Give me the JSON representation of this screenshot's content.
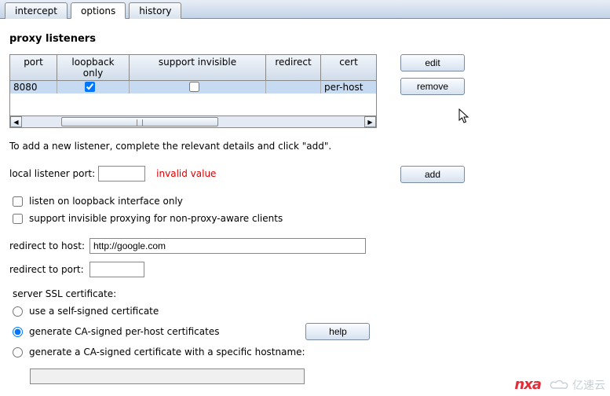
{
  "tabs": {
    "intercept": "intercept",
    "options": "options",
    "history": "history",
    "active": "options"
  },
  "section_title": "proxy listeners",
  "table": {
    "headers": {
      "port": "port",
      "loop": "loopback only",
      "sup": "support invisible",
      "red": "redirect",
      "cert": "cert"
    },
    "rows": [
      {
        "port": "8080",
        "loop": true,
        "sup": false,
        "red": "",
        "cert": "per-host"
      }
    ]
  },
  "buttons": {
    "edit": "edit",
    "remove": "remove",
    "add": "add",
    "help": "help"
  },
  "description": "To add a new listener, complete the relevant details and click \"add\".",
  "form": {
    "port_label": "local listener port:",
    "port_value": "",
    "port_error": "invalid value",
    "chk_loopback": "listen on loopback interface only",
    "chk_invisible": "support invisible proxying for non-proxy-aware clients",
    "redirect_host_label": "redirect to host:",
    "redirect_host_value": "http://google.com",
    "redirect_port_label": "redirect to port:",
    "redirect_port_value": "",
    "ssl_label": "server SSL certificate:",
    "ssl_opts": {
      "self": "use a self-signed certificate",
      "ca": "generate CA-signed per-host certificates",
      "hostname": "generate a CA-signed certificate with a specific hostname:"
    },
    "ssl_selected": "ca",
    "hostname_value": ""
  },
  "watermark": {
    "brand": "nxa",
    "site": "亿速云"
  }
}
